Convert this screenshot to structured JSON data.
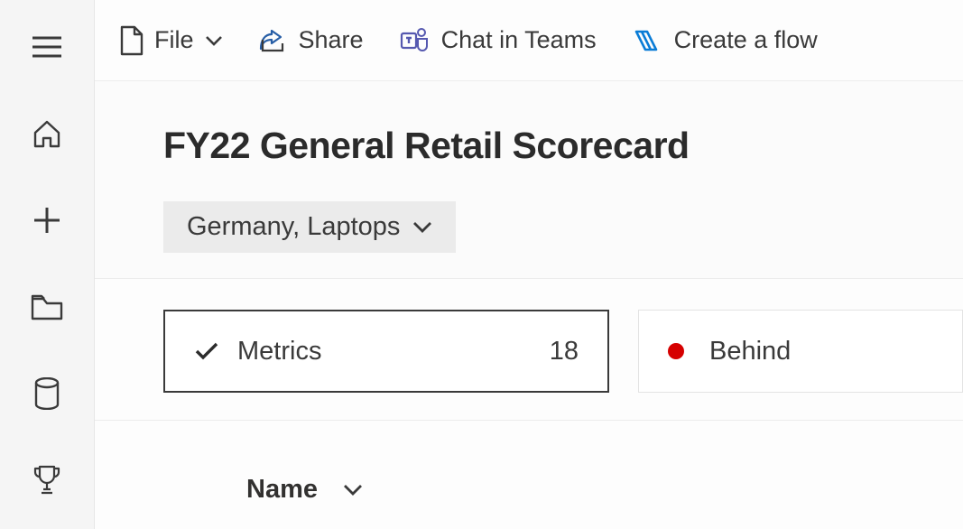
{
  "toolbar": {
    "file_label": "File",
    "share_label": "Share",
    "chat_label": "Chat in Teams",
    "flow_label": "Create a flow"
  },
  "header": {
    "title": "FY22 General Retail Scorecard",
    "filter_label": "Germany, Laptops"
  },
  "cards": {
    "metrics_label": "Metrics",
    "metrics_count": "18",
    "behind_label": "Behind"
  },
  "table": {
    "col_name": "Name"
  }
}
